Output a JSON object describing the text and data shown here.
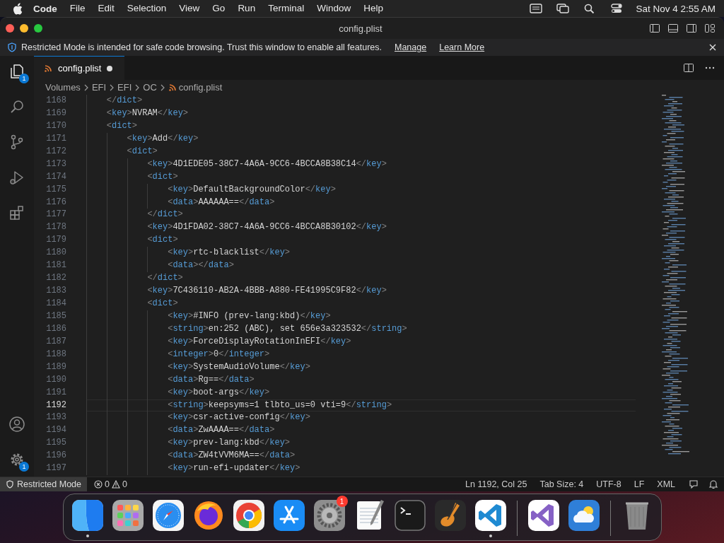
{
  "menu_bar": {
    "app": "Code",
    "items": [
      "File",
      "Edit",
      "Selection",
      "View",
      "Go",
      "Run",
      "Terminal",
      "Window",
      "Help"
    ],
    "clock": "Sat Nov 4  2:55 AM"
  },
  "window": {
    "title": "config.plist"
  },
  "banner": {
    "message": "Restricted Mode is intended for safe code browsing. Trust this window to enable all features.",
    "links": [
      "Manage",
      "Learn More"
    ]
  },
  "activity_bar": {
    "items": [
      {
        "kind": "explorer",
        "selected": true,
        "badge": "1"
      },
      {
        "kind": "search",
        "selected": false
      },
      {
        "kind": "source-control",
        "selected": false
      },
      {
        "kind": "run",
        "selected": false
      },
      {
        "kind": "extensions",
        "selected": false
      }
    ],
    "bottom": [
      {
        "kind": "account"
      },
      {
        "kind": "settings",
        "badge": "1"
      }
    ]
  },
  "tabs": [
    {
      "label": "config.plist",
      "selected": true,
      "modified": true
    }
  ],
  "breadcrumbs": [
    "Volumes",
    "EFI",
    "EFI",
    "OC",
    "config.plist"
  ],
  "editor": {
    "lines": [
      {
        "number": "1168",
        "code": "</dict>",
        "current": false
      },
      {
        "number": "1169",
        "code": "<key>NVRAM</key>",
        "current": false
      },
      {
        "number": "1170",
        "code": "<dict>",
        "current": false,
        "children": [
          {
            "number": "1171",
            "code": "<key>Add</key>",
            "current": false
          },
          {
            "number": "1172",
            "code": "<dict>",
            "current": false,
            "children": [
              {
                "number": "1173",
                "code": "<key>4D1EDE05-38C7-4A6A-9CC6-4BCCA8B38C14</key>",
                "current": false
              },
              {
                "number": "1174",
                "code": "<dict>",
                "current": false,
                "children": [
                  {
                    "number": "1175",
                    "code": "<key>DefaultBackgroundColor</key>",
                    "current": false
                  },
                  {
                    "number": "1176",
                    "code": "<data>AAAAAA==</data>",
                    "current": false
                  }
                ]
              },
              {
                "number": "1177",
                "code": "</dict>",
                "current": false
              },
              {
                "number": "1178",
                "code": "<key>4D1FDA02-38C7-4A6A-9CC6-4BCCA8B30102</key>",
                "current": false
              },
              {
                "number": "1179",
                "code": "<dict>",
                "current": false,
                "children": [
                  {
                    "number": "1180",
                    "code": "<key>rtc-blacklist</key>",
                    "current": false
                  },
                  {
                    "number": "1181",
                    "code": "<data></data>",
                    "current": false
                  }
                ]
              },
              {
                "number": "1182",
                "code": "</dict>",
                "current": false
              },
              {
                "number": "1183",
                "code": "<key>7C436110-AB2A-4BBB-A880-FE41995C9F82</key>",
                "current": false
              },
              {
                "number": "1184",
                "code": "<dict>",
                "current": false,
                "children": [
                  {
                    "number": "1185",
                    "code": "<key>#INFO (prev-lang:kbd)</key>",
                    "current": false
                  },
                  {
                    "number": "1186",
                    "code": "<string>en:252 (ABC), set 656e3a323532</string>",
                    "current": false
                  },
                  {
                    "number": "1187",
                    "code": "<key>ForceDisplayRotationInEFI</key>",
                    "current": false
                  },
                  {
                    "number": "1188",
                    "code": "<integer>0</integer>",
                    "current": false
                  },
                  {
                    "number": "1189",
                    "code": "<key>SystemAudioVolume</key>",
                    "current": false
                  },
                  {
                    "number": "1190",
                    "code": "<data>Rg==</data>",
                    "current": false
                  },
                  {
                    "number": "1191",
                    "code": "<key>boot-args</key>",
                    "current": false
                  },
                  {
                    "number": "1192",
                    "code": "<string>keepsyms=1 tlbto_us=0 vti=9</string>",
                    "current": true
                  },
                  {
                    "number": "1193",
                    "code": "<key>csr-active-config</key>",
                    "current": false
                  },
                  {
                    "number": "1194",
                    "code": "<data>ZwAAAA==</data>",
                    "current": false
                  },
                  {
                    "number": "1195",
                    "code": "<key>prev-lang:kbd</key>",
                    "current": false
                  },
                  {
                    "number": "1196",
                    "code": "<data>ZW4tVVM6MA==</data>",
                    "current": false
                  },
                  {
                    "number": "1197",
                    "code": "<key>run-efi-updater</key>",
                    "current": false
                  }
                ]
              }
            ]
          }
        ]
      }
    ]
  },
  "status_bar": {
    "mode": "Restricted Mode",
    "errors": "0",
    "warnings": "0",
    "items": [
      "Ln 1192, Col 25",
      "Tab Size: 4",
      "UTF-8",
      "LF",
      "XML"
    ]
  },
  "dock": {
    "apps": [
      {
        "kind": "finder",
        "running": true
      },
      {
        "kind": "launchpad",
        "running": false
      },
      {
        "kind": "safari",
        "running": false
      },
      {
        "kind": "firefox",
        "running": false
      },
      {
        "kind": "chrome",
        "running": false
      },
      {
        "kind": "appstore",
        "running": false
      },
      {
        "kind": "settings",
        "running": false,
        "badge": "1"
      },
      {
        "kind": "textedit",
        "running": false
      },
      {
        "kind": "terminal",
        "running": false
      },
      {
        "kind": "garageband",
        "running": false
      },
      {
        "kind": "vscode",
        "running": true
      },
      {
        "kind": "separator"
      },
      {
        "kind": "visualstudio",
        "running": false
      },
      {
        "kind": "weather",
        "running": false
      },
      {
        "kind": "separator"
      },
      {
        "kind": "trash",
        "running": false
      }
    ]
  }
}
